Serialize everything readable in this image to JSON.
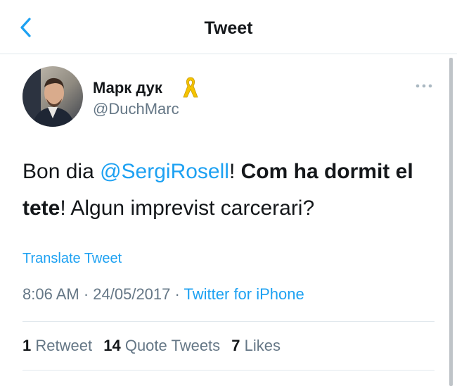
{
  "header": {
    "title": "Tweet",
    "back_icon": "chevron-left-icon",
    "accent": "#1da1f2"
  },
  "tweet": {
    "author": {
      "name": "Марк дук",
      "handle": "@DuchMarc",
      "badge_icon": "yellow-ribbon-icon"
    },
    "text": {
      "part1": "Bon dia ",
      "mention": "@SergiRosell",
      "part2": "! ",
      "bold1": "Com ha dormit el tete",
      "part3": "! Algun imprevist carcerari?"
    },
    "translate_label": "Translate Tweet",
    "time": "8:06 AM",
    "separator1": " · ",
    "date": "24/05/2017",
    "separator2": " · ",
    "source": "Twitter for iPhone",
    "stats": {
      "retweets_count": "1",
      "retweets_label": "Retweet",
      "quotes_count": "14",
      "quotes_label": "Quote Tweets",
      "likes_count": "7",
      "likes_label": "Likes"
    }
  },
  "colors": {
    "text": "#14171a",
    "secondary": "#657786",
    "divider": "#e1e8ed",
    "link": "#1da1f2"
  }
}
